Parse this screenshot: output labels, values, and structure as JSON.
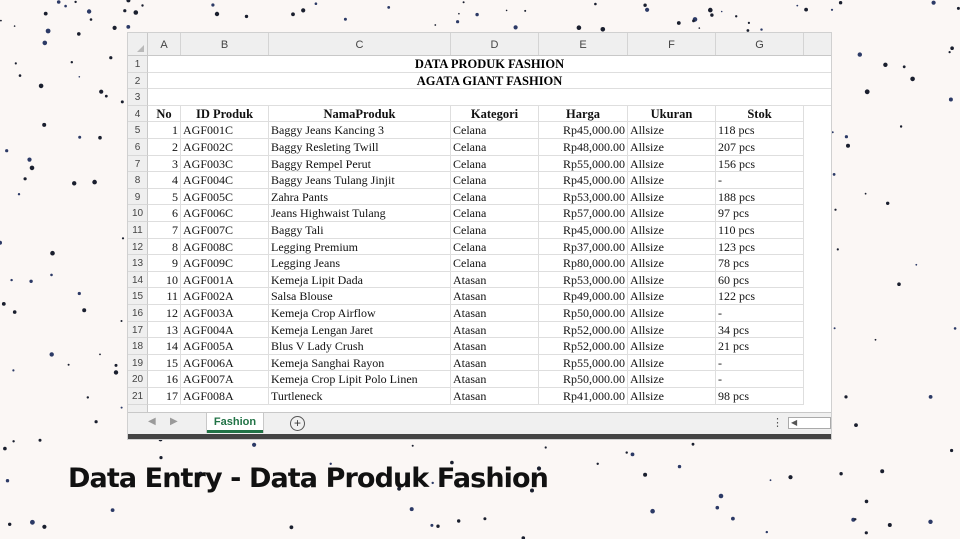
{
  "caption": "Data Entry - Data Produk Fashion",
  "spreadsheet": {
    "column_letters": [
      "A",
      "B",
      "C",
      "D",
      "E",
      "F",
      "G"
    ],
    "title1": "DATA PRODUK FASHION",
    "title2": "AGATA GIANT FASHION",
    "headers": [
      "No",
      "ID Produk",
      "NamaProduk",
      "Kategori",
      "Harga",
      "Ukuran",
      "Stok"
    ],
    "rows": [
      [
        "1",
        "AGF001C",
        "Baggy Jeans Kancing 3",
        "Celana",
        "Rp45,000.00",
        "Allsize",
        "118 pcs"
      ],
      [
        "2",
        "AGF002C",
        "Baggy Resleting Twill",
        "Celana",
        "Rp48,000.00",
        "Allsize",
        "207 pcs"
      ],
      [
        "3",
        "AGF003C",
        "Baggy Rempel Perut",
        "Celana",
        "Rp55,000.00",
        "Allsize",
        "156 pcs"
      ],
      [
        "4",
        "AGF004C",
        "Baggy Jeans Tulang Jinjit",
        "Celana",
        "Rp45,000.00",
        "Allsize",
        "-"
      ],
      [
        "5",
        "AGF005C",
        "Zahra Pants",
        "Celana",
        "Rp53,000.00",
        "Allsize",
        "188 pcs"
      ],
      [
        "6",
        "AGF006C",
        "Jeans Highwaist Tulang",
        "Celana",
        "Rp57,000.00",
        "Allsize",
        "97 pcs"
      ],
      [
        "7",
        "AGF007C",
        "Baggy Tali",
        "Celana",
        "Rp45,000.00",
        "Allsize",
        "110 pcs"
      ],
      [
        "8",
        "AGF008C",
        "Legging Premium",
        "Celana",
        "Rp37,000.00",
        "Allsize",
        "123 pcs"
      ],
      [
        "9",
        "AGF009C",
        "Legging Jeans",
        "Celana",
        "Rp80,000.00",
        "Allsize",
        "78 pcs"
      ],
      [
        "10",
        "AGF001A",
        "Kemeja Lipit Dada",
        "Atasan",
        "Rp53,000.00",
        "Allsize",
        "60 pcs"
      ],
      [
        "11",
        "AGF002A",
        "Salsa Blouse",
        "Atasan",
        "Rp49,000.00",
        "Allsize",
        "122 pcs"
      ],
      [
        "12",
        "AGF003A",
        "Kemeja Crop Airflow",
        "Atasan",
        "Rp50,000.00",
        "Allsize",
        "-"
      ],
      [
        "13",
        "AGF004A",
        "Kemeja Lengan Jaret",
        "Atasan",
        "Rp52,000.00",
        "Allsize",
        "34 pcs"
      ],
      [
        "14",
        "AGF005A",
        "Blus V Lady Crush",
        "Atasan",
        "Rp52,000.00",
        "Allsize",
        "21 pcs"
      ],
      [
        "15",
        "AGF006A",
        "Kemeja Sanghai Rayon",
        "Atasan",
        "Rp55,000.00",
        "Allsize",
        "-"
      ],
      [
        "16",
        "AGF007A",
        "Kemeja Crop Lipit Polo Linen",
        "Atasan",
        "Rp50,000.00",
        "Allsize",
        "-"
      ],
      [
        "17",
        "AGF008A",
        "Turtleneck",
        "Atasan",
        "Rp41,000.00",
        "Allsize",
        "98 pcs"
      ]
    ],
    "sheet_tab": "Fashion",
    "add_sheet_symbol": "+",
    "more_symbol": "⋮",
    "nav_prev": "◀",
    "nav_next": "▶",
    "scroll_left": "◀",
    "accent_color": "#217346"
  }
}
